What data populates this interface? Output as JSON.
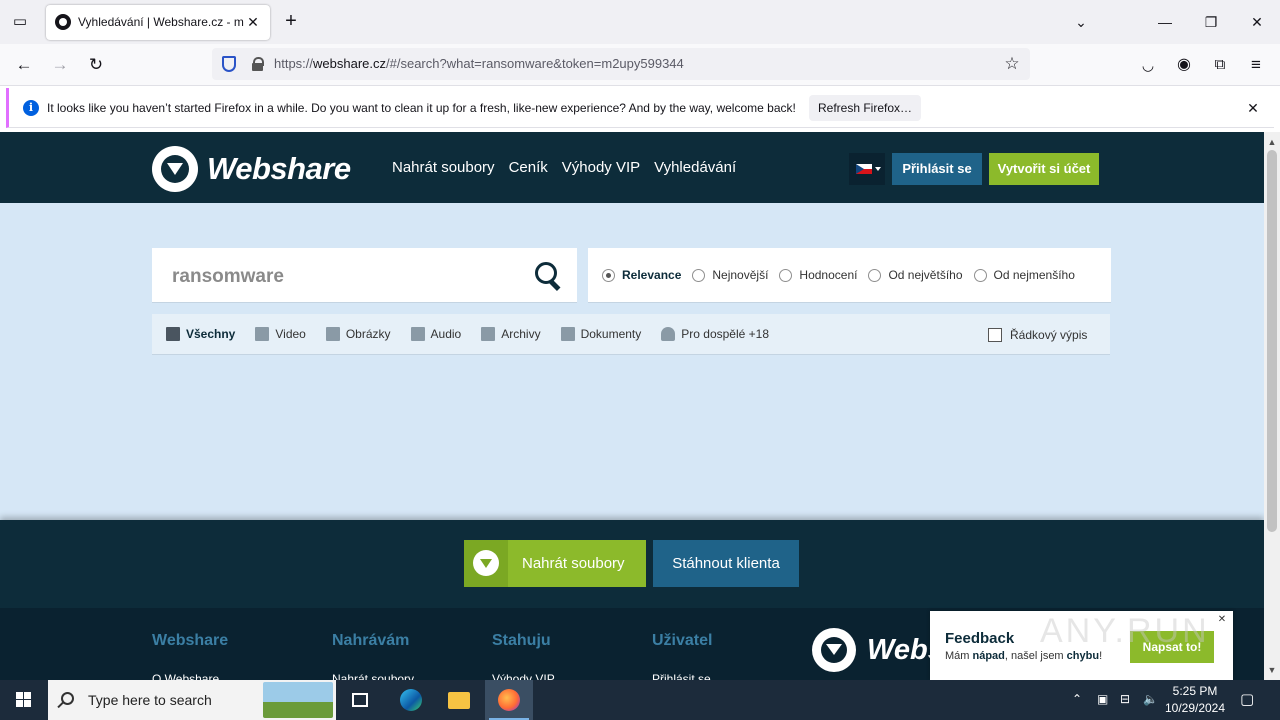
{
  "browser": {
    "tab_title": "Vyhledávání | Webshare.cz - mo",
    "url_prefix": "https://",
    "url_host": "webshare.cz",
    "url_path": "/#/search?what=ransomware&token=m2upy599344",
    "notification": {
      "message": "It looks like you haven’t started Firefox in a while. Do you want to clean it up for a fresh, like-new experience? And by the way, welcome back!",
      "button": "Refresh Firefox…"
    }
  },
  "site": {
    "logo": "Webshare",
    "nav": [
      "Nahrát soubory",
      "Ceník",
      "Výhody VIP",
      "Vyhledávání"
    ],
    "login": "Přihlásit se",
    "register": "Vytvořit si účet"
  },
  "search": {
    "query": "ransomware",
    "sort": [
      {
        "label": "Relevance",
        "selected": true
      },
      {
        "label": "Nejnovější",
        "selected": false
      },
      {
        "label": "Hodnocení",
        "selected": false
      },
      {
        "label": "Od největšího",
        "selected": false
      },
      {
        "label": "Od nejmenšího",
        "selected": false
      }
    ],
    "filters": [
      {
        "label": "Všechny",
        "icon": "document-icon",
        "active": true
      },
      {
        "label": "Video",
        "icon": "film-icon",
        "active": false
      },
      {
        "label": "Obrázky",
        "icon": "image-icon",
        "active": false
      },
      {
        "label": "Audio",
        "icon": "speaker-icon",
        "active": false
      },
      {
        "label": "Archivy",
        "icon": "archive-icon",
        "active": false
      },
      {
        "label": "Dokumenty",
        "icon": "document-icon",
        "active": false
      },
      {
        "label": "Pro dospělé +18",
        "icon": "person-icon",
        "active": false
      }
    ],
    "row_list_label": "Řádkový výpis",
    "row_list_checked": false
  },
  "footer": {
    "upload": "Nahrát soubory",
    "client": "Stáhnout klienta",
    "columns": [
      {
        "heading": "Webshare",
        "first_link": "O Webshare"
      },
      {
        "heading": "Nahrávám",
        "first_link": "Nahrát soubory"
      },
      {
        "heading": "Stahuju",
        "first_link": "Výhody VIP"
      },
      {
        "heading": "Uživatel",
        "first_link": "Přihlásit se"
      }
    ],
    "logo": "Webs"
  },
  "feedback": {
    "title": "Feedback",
    "text_a": "Mám ",
    "text_b": "nápad",
    "text_c": ", našel jsem ",
    "text_d": "chybu",
    "text_e": "!",
    "button": "Napsat to!"
  },
  "watermark": "ANY.RUN",
  "taskbar": {
    "search_placeholder": "Type here to search",
    "time": "5:25 PM",
    "date": "10/29/2024"
  },
  "colors": {
    "header": "#0d2c3a",
    "accent_green": "#8cba2b",
    "accent_blue": "#1f6389",
    "page_bg": "#d6e7f6"
  }
}
